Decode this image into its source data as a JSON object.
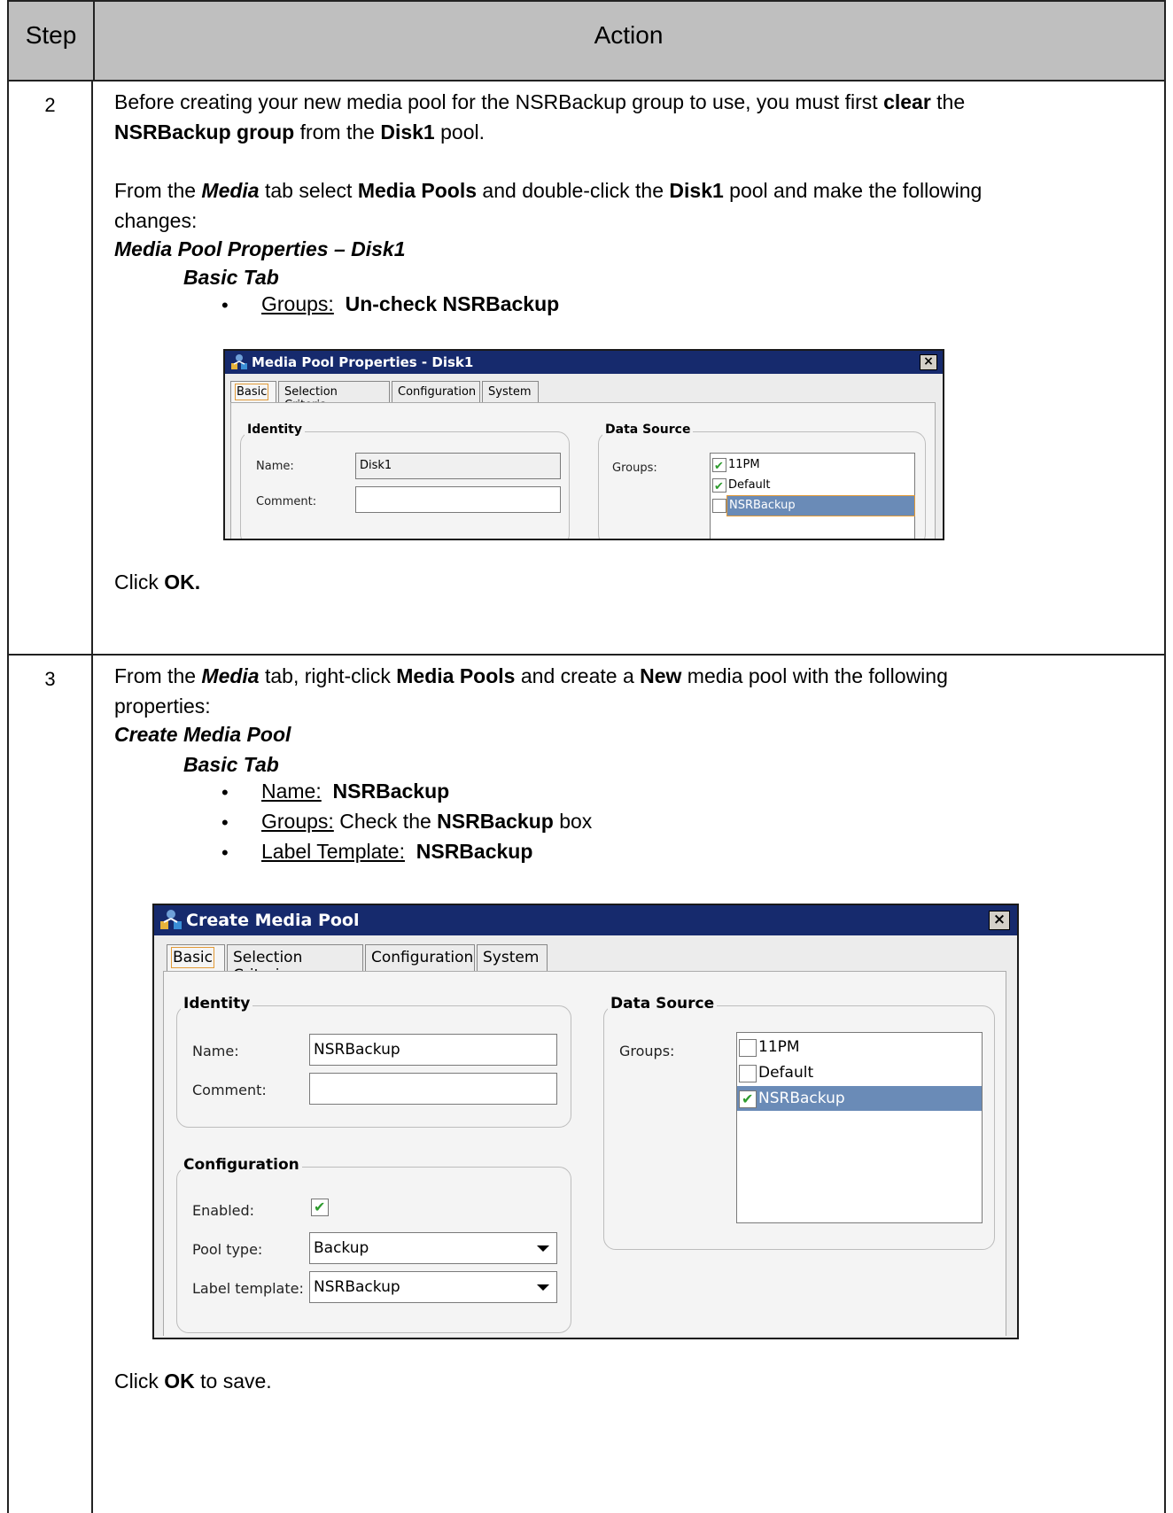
{
  "header": {
    "step": "Step",
    "action": "Action"
  },
  "row2": {
    "step": "2",
    "p1_a": "Before creating your new media pool for the NSRBackup group to use, you must first ",
    "p1_b": "clear",
    "p1_c": " the",
    "p2_a": "NSRBackup group",
    "p2_b": " from the ",
    "p2_c": "Disk1",
    "p2_d": " pool.",
    "p3_a": "From the ",
    "p3_b": "Media",
    "p3_c": " tab select ",
    "p3_d": "Media Pools",
    "p3_e": " and double-click the ",
    "p3_f": "Disk1",
    "p3_g": " pool and make the following",
    "p4": "changes:",
    "h1": "Media Pool Properties – Disk1",
    "h2": "Basic Tab",
    "bullet_label": "Groups:",
    "bullet_value": "Un-check NSRBackup",
    "click_a": "Click ",
    "click_b": "OK."
  },
  "dialog1": {
    "title": "Media Pool Properties - Disk1",
    "tabs": [
      "Basic",
      "Selection Criteria",
      "Configuration",
      "System"
    ],
    "identity": "Identity",
    "name_label": "Name:",
    "name_value": "Disk1",
    "comment_label": "Comment:",
    "data_source": "Data Source",
    "groups_label": "Groups:",
    "groups": [
      {
        "label": "11PM",
        "checked": true
      },
      {
        "label": "Default",
        "checked": true
      },
      {
        "label": "NSRBackup",
        "checked": false
      }
    ],
    "close": "×"
  },
  "row3": {
    "step": "3",
    "p1_a": "From the ",
    "p1_b": "Media",
    "p1_c": " tab, right-click ",
    "p1_d": "Media Pools",
    "p1_e": " and create a ",
    "p1_f": "New",
    "p1_g": " media pool with the following",
    "p2": "properties:",
    "h1": "Create Media Pool",
    "h2": "Basic Tab",
    "b1_label": "Name:",
    "b1_value": "NSRBackup",
    "b2_label": "Groups:",
    "b2_a": "  Check the ",
    "b2_b": "NSRBackup",
    "b2_c": " box",
    "b3_label": "Label Template:",
    "b3_value": "NSRBackup",
    "click_a": "Click ",
    "click_b": "OK",
    "click_c": " to save."
  },
  "dialog2": {
    "title": "Create Media Pool",
    "tabs": [
      "Basic",
      "Selection Criteria",
      "Configuration",
      "System"
    ],
    "identity": "Identity",
    "name_label": "Name:",
    "name_value": "NSRBackup",
    "comment_label": "Comment:",
    "configuration": "Configuration",
    "enabled_label": "Enabled:",
    "pool_type_label": "Pool type:",
    "pool_type_value": "Backup",
    "label_template_label": "Label template:",
    "label_template_value": "NSRBackup",
    "data_source": "Data Source",
    "groups_label": "Groups:",
    "groups": [
      {
        "label": "11PM",
        "checked": false
      },
      {
        "label": "Default",
        "checked": false
      },
      {
        "label": "NSRBackup",
        "checked": true
      }
    ],
    "close": "×"
  }
}
